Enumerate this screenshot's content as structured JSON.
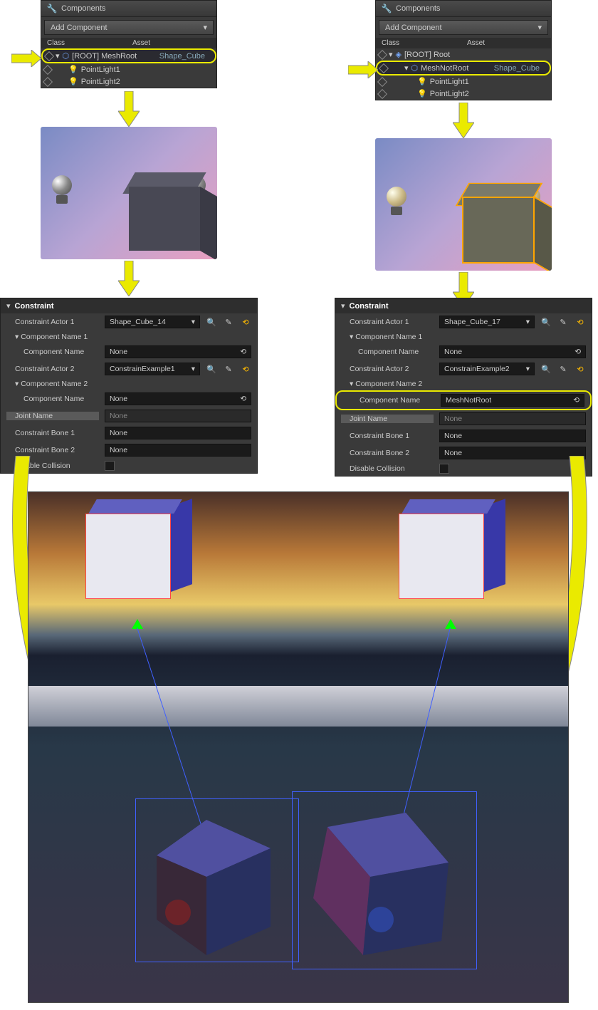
{
  "left": {
    "components": {
      "title": "Components",
      "addBtn": "Add Component",
      "headers": {
        "class": "Class",
        "asset": "Asset"
      },
      "root": {
        "label": "[ROOT] MeshRoot",
        "asset": "Shape_Cube"
      },
      "light1": "PointLight1",
      "light2": "PointLight2"
    },
    "constraint": {
      "title": "Constraint",
      "actor1Label": "Constraint Actor 1",
      "actor1Value": "Shape_Cube_14",
      "compName1Label": "Component Name 1",
      "compNameLabel": "Component Name",
      "compNameValue1": "None",
      "actor2Label": "Constraint Actor 2",
      "actor2Value": "ConstrainExample1",
      "compName2Label": "Component Name 2",
      "compNameValue2": "None",
      "jointNameLabel": "Joint Name",
      "jointNameValue": "None",
      "bone1Label": "Constraint Bone 1",
      "bone1Value": "None",
      "bone2Label": "Constraint Bone 2",
      "bone2Value": "None",
      "disableCollisionLabel": "Disable Collision"
    }
  },
  "right": {
    "components": {
      "title": "Components",
      "addBtn": "Add Component",
      "headers": {
        "class": "Class",
        "asset": "Asset"
      },
      "root": {
        "label": "[ROOT] Root"
      },
      "mesh": {
        "label": "MeshNotRoot",
        "asset": "Shape_Cube"
      },
      "light1": "PointLight1",
      "light2": "PointLight2"
    },
    "constraint": {
      "title": "Constraint",
      "actor1Label": "Constraint Actor 1",
      "actor1Value": "Shape_Cube_17",
      "compName1Label": "Component Name 1",
      "compNameLabel": "Component Name",
      "compNameValue1": "None",
      "actor2Label": "Constraint Actor 2",
      "actor2Value": "ConstrainExample2",
      "compName2Label": "Component Name 2",
      "compNameValue2": "MeshNotRoot",
      "jointNameLabel": "Joint Name",
      "jointNameValue": "None",
      "bone1Label": "Constraint Bone 1",
      "bone1Value": "None",
      "bone2Label": "Constraint Bone 2",
      "bone2Value": "None",
      "disableCollisionLabel": "Disable Collision"
    }
  }
}
